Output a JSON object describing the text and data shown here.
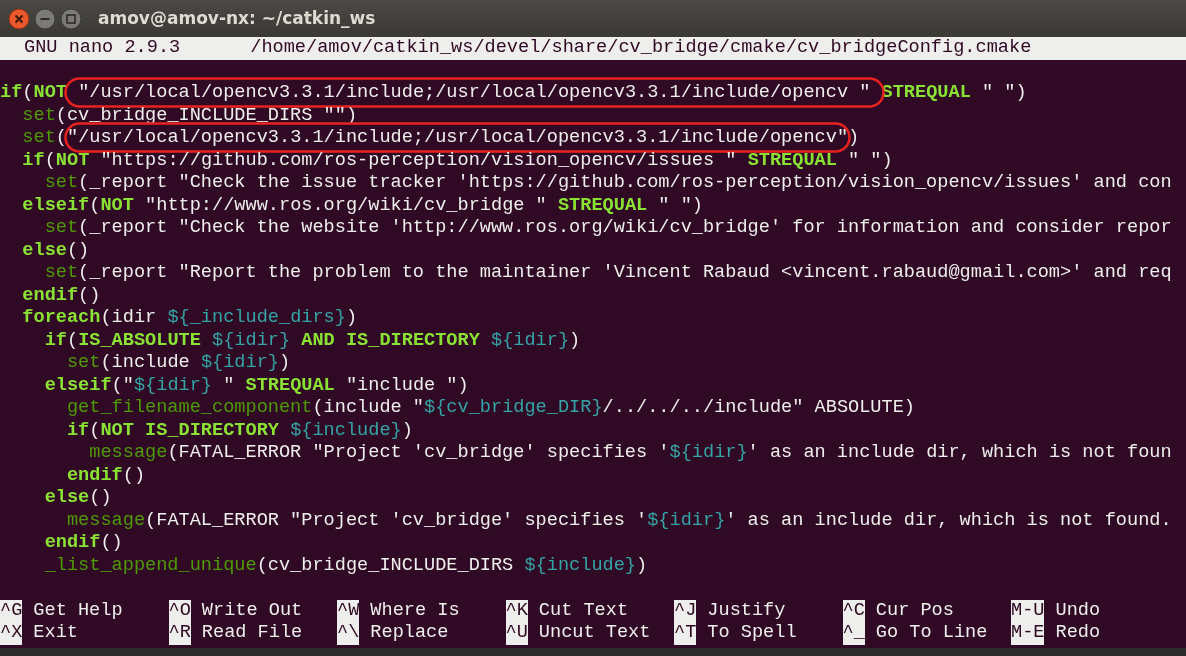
{
  "window": {
    "title": "amov@amov-nx: ~/catkin_ws"
  },
  "editor": {
    "program": "GNU nano 2.9.3",
    "file_path": "/home/amov/catkin_ws/devel/share/cv_bridge/cmake/cv_bridgeConfig.cmake"
  },
  "lines": [
    {
      "tokens": [
        {
          "kind": "keyword",
          "text": "if"
        },
        {
          "kind": "text",
          "text": "("
        },
        {
          "kind": "keyword",
          "text": "NOT"
        },
        {
          "kind": "text",
          "text": " \"/usr/local/opencv3.3.1/include;/usr/local/opencv3.3.1/include/opencv \" ",
          "circled": true
        },
        {
          "kind": "keyword",
          "text": "STREQUAL"
        },
        {
          "kind": "text",
          "text": " \" \")"
        }
      ]
    },
    {
      "tokens": [
        {
          "kind": "command",
          "text": "  set"
        },
        {
          "kind": "text",
          "text": "(cv_bridge_INCLUDE_DIRS \"\")"
        }
      ]
    },
    {
      "tokens": [
        {
          "kind": "command",
          "text": "  set"
        },
        {
          "kind": "text",
          "text": "("
        },
        {
          "kind": "text",
          "text": "\"/usr/local/opencv3.3.1/include;/usr/local/opencv3.3.1/include/opencv\"",
          "circled": true
        },
        {
          "kind": "text",
          "text": ")"
        }
      ]
    },
    {
      "tokens": [
        {
          "kind": "keyword",
          "text": "  if"
        },
        {
          "kind": "text",
          "text": "("
        },
        {
          "kind": "keyword",
          "text": "NOT"
        },
        {
          "kind": "text",
          "text": " \"https://github.com/ros-perception/vision_opencv/issues \" "
        },
        {
          "kind": "keyword",
          "text": "STREQUAL"
        },
        {
          "kind": "text",
          "text": " \" \")"
        }
      ]
    },
    {
      "tokens": [
        {
          "kind": "command",
          "text": "    set"
        },
        {
          "kind": "text",
          "text": "(_report \"Check the issue tracker 'https://github.com/ros-perception/vision_opencv/issues' and con"
        }
      ]
    },
    {
      "tokens": [
        {
          "kind": "keyword",
          "text": "  elseif"
        },
        {
          "kind": "text",
          "text": "("
        },
        {
          "kind": "keyword",
          "text": "NOT"
        },
        {
          "kind": "text",
          "text": " \"http://www.ros.org/wiki/cv_bridge \" "
        },
        {
          "kind": "keyword",
          "text": "STREQUAL"
        },
        {
          "kind": "text",
          "text": " \" \")"
        }
      ]
    },
    {
      "tokens": [
        {
          "kind": "command",
          "text": "    set"
        },
        {
          "kind": "text",
          "text": "(_report \"Check the website 'http://www.ros.org/wiki/cv_bridge' for information and consider repor"
        }
      ]
    },
    {
      "tokens": [
        {
          "kind": "keyword",
          "text": "  else"
        },
        {
          "kind": "text",
          "text": "()"
        }
      ]
    },
    {
      "tokens": [
        {
          "kind": "command",
          "text": "    set"
        },
        {
          "kind": "text",
          "text": "(_report \"Report the problem to the maintainer 'Vincent Rabaud <vincent.rabaud@gmail.com>' and req"
        }
      ]
    },
    {
      "tokens": [
        {
          "kind": "keyword",
          "text": "  endif"
        },
        {
          "kind": "text",
          "text": "()"
        }
      ]
    },
    {
      "tokens": [
        {
          "kind": "keyword",
          "text": "  foreach"
        },
        {
          "kind": "text",
          "text": "(idir "
        },
        {
          "kind": "variable",
          "text": "${_include_dirs}"
        },
        {
          "kind": "text",
          "text": ")"
        }
      ]
    },
    {
      "tokens": [
        {
          "kind": "keyword",
          "text": "    if"
        },
        {
          "kind": "text",
          "text": "("
        },
        {
          "kind": "keyword",
          "text": "IS_ABSOLUTE"
        },
        {
          "kind": "variable",
          "text": " ${idir}"
        },
        {
          "kind": "keyword",
          "text": " AND IS_DIRECTORY"
        },
        {
          "kind": "variable",
          "text": " ${idir}"
        },
        {
          "kind": "text",
          "text": ")"
        }
      ]
    },
    {
      "tokens": [
        {
          "kind": "command",
          "text": "      set"
        },
        {
          "kind": "text",
          "text": "(include "
        },
        {
          "kind": "variable",
          "text": "${idir}"
        },
        {
          "kind": "text",
          "text": ")"
        }
      ]
    },
    {
      "tokens": [
        {
          "kind": "keyword",
          "text": "    elseif"
        },
        {
          "kind": "text",
          "text": "(\""
        },
        {
          "kind": "variable",
          "text": "${idir}"
        },
        {
          "kind": "text",
          "text": " \" "
        },
        {
          "kind": "keyword",
          "text": "STREQUAL"
        },
        {
          "kind": "text",
          "text": " \"include \")"
        }
      ]
    },
    {
      "tokens": [
        {
          "kind": "command",
          "text": "      get_filename_component"
        },
        {
          "kind": "text",
          "text": "(include \""
        },
        {
          "kind": "variable",
          "text": "${cv_bridge_DIR}"
        },
        {
          "kind": "text",
          "text": "/../../../include\" ABSOLUTE)"
        }
      ]
    },
    {
      "tokens": [
        {
          "kind": "keyword",
          "text": "      if"
        },
        {
          "kind": "text",
          "text": "("
        },
        {
          "kind": "keyword",
          "text": "NOT IS_DIRECTORY"
        },
        {
          "kind": "variable",
          "text": " ${include}"
        },
        {
          "kind": "text",
          "text": ")"
        }
      ]
    },
    {
      "tokens": [
        {
          "kind": "command",
          "text": "        message"
        },
        {
          "kind": "text",
          "text": "(FATAL_ERROR \"Project 'cv_bridge' specifies '"
        },
        {
          "kind": "variable",
          "text": "${idir}"
        },
        {
          "kind": "text",
          "text": "' as an include dir, which is not foun"
        }
      ]
    },
    {
      "tokens": [
        {
          "kind": "keyword",
          "text": "      endif"
        },
        {
          "kind": "text",
          "text": "()"
        }
      ]
    },
    {
      "tokens": [
        {
          "kind": "keyword",
          "text": "    else"
        },
        {
          "kind": "text",
          "text": "()"
        }
      ]
    },
    {
      "tokens": [
        {
          "kind": "command",
          "text": "      message"
        },
        {
          "kind": "text",
          "text": "(FATAL_ERROR \"Project 'cv_bridge' specifies '"
        },
        {
          "kind": "variable",
          "text": "${idir}"
        },
        {
          "kind": "text",
          "text": "' as an include dir, which is not found."
        }
      ]
    },
    {
      "tokens": [
        {
          "kind": "keyword",
          "text": "    endif"
        },
        {
          "kind": "text",
          "text": "()"
        }
      ]
    },
    {
      "tokens": [
        {
          "kind": "command",
          "text": "    _list_append_unique"
        },
        {
          "kind": "text",
          "text": "(cv_bridge_INCLUDE_DIRS "
        },
        {
          "kind": "variable",
          "text": "${include}"
        },
        {
          "kind": "text",
          "text": ")"
        }
      ]
    }
  ],
  "shortcuts": [
    {
      "key": "^G",
      "label": "Get Help"
    },
    {
      "key": "^O",
      "label": "Write Out"
    },
    {
      "key": "^W",
      "label": "Where Is"
    },
    {
      "key": "^K",
      "label": "Cut Text"
    },
    {
      "key": "^J",
      "label": "Justify"
    },
    {
      "key": "^C",
      "label": "Cur Pos"
    },
    {
      "key": "M-U",
      "label": "Undo"
    },
    {
      "key": "^X",
      "label": "Exit"
    },
    {
      "key": "^R",
      "label": "Read File"
    },
    {
      "key": "^\\",
      "label": "Replace"
    },
    {
      "key": "^U",
      "label": "Uncut Text"
    },
    {
      "key": "^T",
      "label": "To Spell"
    },
    {
      "key": "^_",
      "label": "Go To Line"
    },
    {
      "key": "M-E",
      "label": "Redo"
    }
  ]
}
